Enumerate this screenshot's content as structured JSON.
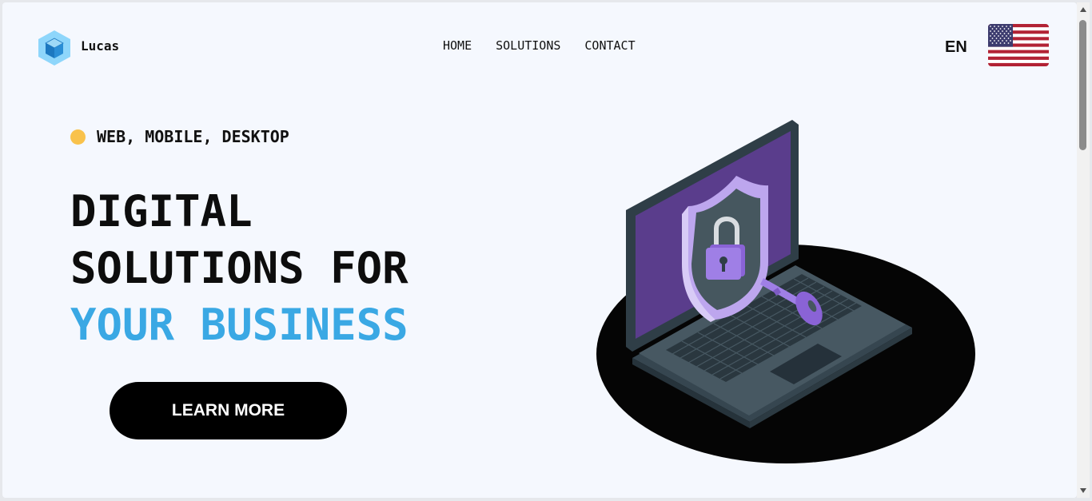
{
  "header": {
    "brand": "Lucas",
    "logo_icon": "cube-logo-icon",
    "nav": [
      {
        "label": "HOME"
      },
      {
        "label": "SOLUTIONS"
      },
      {
        "label": "CONTACT"
      }
    ],
    "language": "EN",
    "flag_icon": "us-flag-icon"
  },
  "hero": {
    "tag": "WEB, MOBILE, DESKTOP",
    "headline_line1": "DIGITAL",
    "headline_line2": "SOLUTIONS FOR",
    "headline_line3": "YOUR BUSINESS",
    "cta_label": "LEARN MORE",
    "illustration_icon": "laptop-security-illustration"
  },
  "colors": {
    "accent_blue": "#3aa8e4",
    "tag_dot": "#f9c24b",
    "button_bg": "#000000",
    "page_bg": "#f5f8fe"
  }
}
